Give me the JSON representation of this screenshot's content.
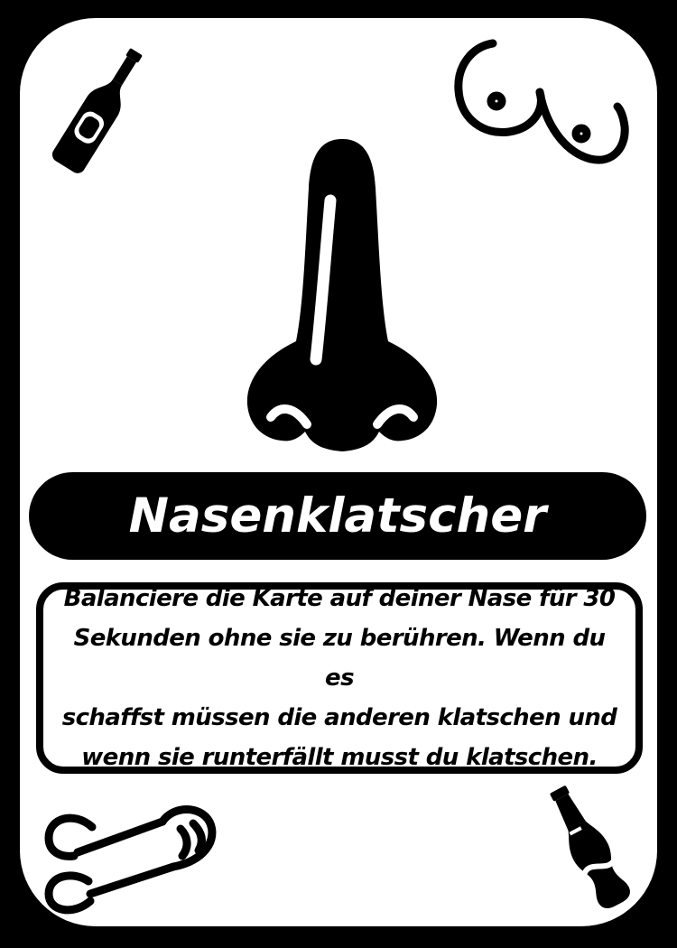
{
  "card": {
    "title": "Nasenklatscher",
    "description": "Balanciere die Karte auf deiner Nase für 30\nSekunden ohne sie zu berühren. Wenn du es\nschaffst müssen die anderen klatschen und\nwenn sie runterfällt musst du klatschen.",
    "colors": {
      "background": "#000000",
      "card": "#ffffff",
      "ink": "#000000"
    }
  },
  "icons": {
    "top_left": "beer-bottle-icon",
    "top_right": "breasts-icon",
    "center": "nose-icon",
    "bottom_left": "penis-icon",
    "bottom_right": "soda-bottle-icon"
  }
}
